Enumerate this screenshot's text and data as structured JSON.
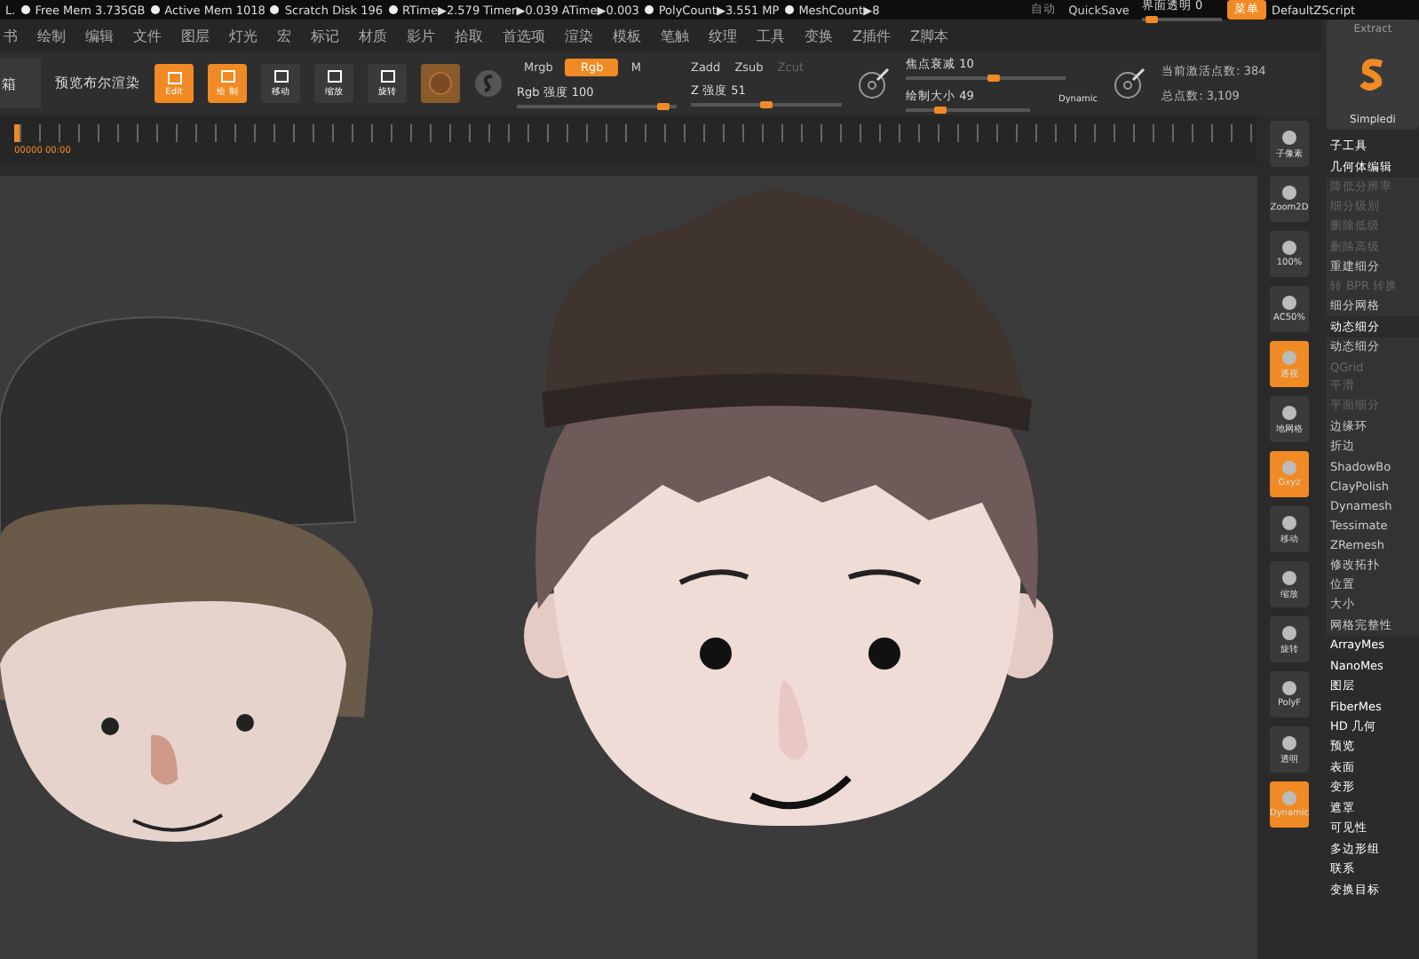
{
  "status_bar": {
    "items": [
      "L.",
      "Free Mem 3.735GB",
      "Active Mem 1018",
      "Scratch Disk 196",
      "RTime▶2.579 Timer▶0.039 ATime▶0.003",
      "PolyCount▶3.551 MP",
      "MeshCount▶8"
    ],
    "auto": "自动",
    "quicksave": "QuickSave",
    "transparency": {
      "label": "界面透明 0",
      "level": 0.05
    },
    "menu_button": "菜单",
    "script": "DefaultZScript"
  },
  "menu": [
    "书",
    "绘制",
    "编辑",
    "文件",
    "图层",
    "灯光",
    "宏",
    "标记",
    "材质",
    "影片",
    "拾取",
    "首选项",
    "渲染",
    "模板",
    "笔触",
    "纹理",
    "工具",
    "变换",
    "Z插件",
    "Z脚本"
  ],
  "toolbar": {
    "box_label": "箱",
    "preview": "预览布尔渲染",
    "modes": [
      {
        "label": "Edit",
        "selected": true
      },
      {
        "label": "绘 制",
        "selected": true
      },
      {
        "label": "移动",
        "selected": false
      },
      {
        "label": "缩放",
        "selected": false
      },
      {
        "label": "旋转",
        "selected": false
      }
    ],
    "channels": [
      {
        "label": "Mrgb",
        "selected": false
      },
      {
        "label": "Rgb",
        "selected": true
      },
      {
        "label": "M",
        "selected": false
      }
    ],
    "rgb_intensity": {
      "label": "Rgb 强度 100",
      "level": 0.95
    },
    "depth_modes": [
      {
        "label": "Zadd",
        "disabled": false
      },
      {
        "label": "Zsub",
        "disabled": false
      },
      {
        "label": "Zcut",
        "disabled": true
      }
    ],
    "z_intensity": {
      "label": "Z 强度 51",
      "level": 0.5
    },
    "focal_shift": {
      "label": "焦点衰减 10",
      "level": 0.55
    },
    "draw_size": {
      "label": "绘制大小 49",
      "level": 0.25
    },
    "dynamic": "Dynamic",
    "active_points": "当前激活点数: 384",
    "total_points": "总点数: 3,109"
  },
  "timeline": {
    "time": "00000 00:00"
  },
  "shelf": [
    {
      "label": "子像素",
      "selected": false
    },
    {
      "label": "Zoom2D",
      "selected": false
    },
    {
      "label": "100%",
      "selected": false
    },
    {
      "label": "AC50%",
      "selected": false
    },
    {
      "label": "透视",
      "selected": true
    },
    {
      "label": "地网格",
      "selected": false
    },
    {
      "label": "Gxyz",
      "selected": true
    },
    {
      "label": "移动",
      "selected": false
    },
    {
      "label": "缩放",
      "selected": false
    },
    {
      "label": "旋转",
      "selected": false
    },
    {
      "label": "PolyF",
      "selected": false
    },
    {
      "label": "透明",
      "selected": false
    },
    {
      "label": "Dynamic",
      "selected": true
    }
  ],
  "tool_panel": {
    "extract": "Extract",
    "brush": "Simpledi",
    "items": [
      {
        "label": "子工具",
        "kind": "header",
        "disabled": false
      },
      {
        "label": "几何体编辑",
        "kind": "header",
        "disabled": false
      },
      {
        "label": "降低分辨率",
        "kind": "item",
        "disabled": true
      },
      {
        "label": "细分级别",
        "kind": "item",
        "disabled": true
      },
      {
        "label": "删除低级",
        "kind": "item",
        "disabled": true
      },
      {
        "label": "删除高级",
        "kind": "item",
        "disabled": true
      },
      {
        "label": "重建细分",
        "kind": "item",
        "disabled": false
      },
      {
        "label": "转 BPR 转换",
        "kind": "item",
        "disabled": true
      },
      {
        "label": "细分网格",
        "kind": "item",
        "disabled": false
      },
      {
        "label": "动态细分",
        "kind": "header",
        "disabled": false
      },
      {
        "label": "动态细分",
        "kind": "item",
        "disabled": false
      },
      {
        "label": "QGrid",
        "kind": "item",
        "disabled": true
      },
      {
        "label": "平滑",
        "kind": "item",
        "disabled": true
      },
      {
        "label": "平面细分",
        "kind": "item",
        "disabled": true
      },
      {
        "label": "边缘环",
        "kind": "item",
        "disabled": false
      },
      {
        "label": "折边",
        "kind": "item",
        "disabled": false
      },
      {
        "label": "ShadowBo",
        "kind": "item",
        "disabled": false
      },
      {
        "label": "ClayPolish",
        "kind": "item",
        "disabled": false
      },
      {
        "label": "Dynamesh",
        "kind": "item",
        "disabled": false
      },
      {
        "label": "Tessimate",
        "kind": "item",
        "disabled": false
      },
      {
        "label": "ZRemesh",
        "kind": "item",
        "disabled": false
      },
      {
        "label": "修改拓扑",
        "kind": "item",
        "disabled": false
      },
      {
        "label": "位置",
        "kind": "item",
        "disabled": false
      },
      {
        "label": "大小",
        "kind": "item",
        "disabled": false
      },
      {
        "label": "网格完整性",
        "kind": "item",
        "disabled": false
      },
      {
        "label": "ArrayMes",
        "kind": "header",
        "disabled": false
      },
      {
        "label": "NanoMes",
        "kind": "header",
        "disabled": false
      },
      {
        "label": "图层",
        "kind": "header",
        "disabled": false
      },
      {
        "label": "FiberMes",
        "kind": "header",
        "disabled": false
      },
      {
        "label": "HD 几何",
        "kind": "header",
        "disabled": false
      },
      {
        "label": "预览",
        "kind": "header",
        "disabled": false
      },
      {
        "label": "表面",
        "kind": "header",
        "disabled": false
      },
      {
        "label": "变形",
        "kind": "header",
        "disabled": false
      },
      {
        "label": "遮罩",
        "kind": "header",
        "disabled": false
      },
      {
        "label": "可见性",
        "kind": "header",
        "disabled": false
      },
      {
        "label": "多边形组",
        "kind": "header",
        "disabled": false
      },
      {
        "label": "联系",
        "kind": "header",
        "disabled": false
      },
      {
        "label": "变换目标",
        "kind": "header",
        "disabled": false
      }
    ]
  }
}
